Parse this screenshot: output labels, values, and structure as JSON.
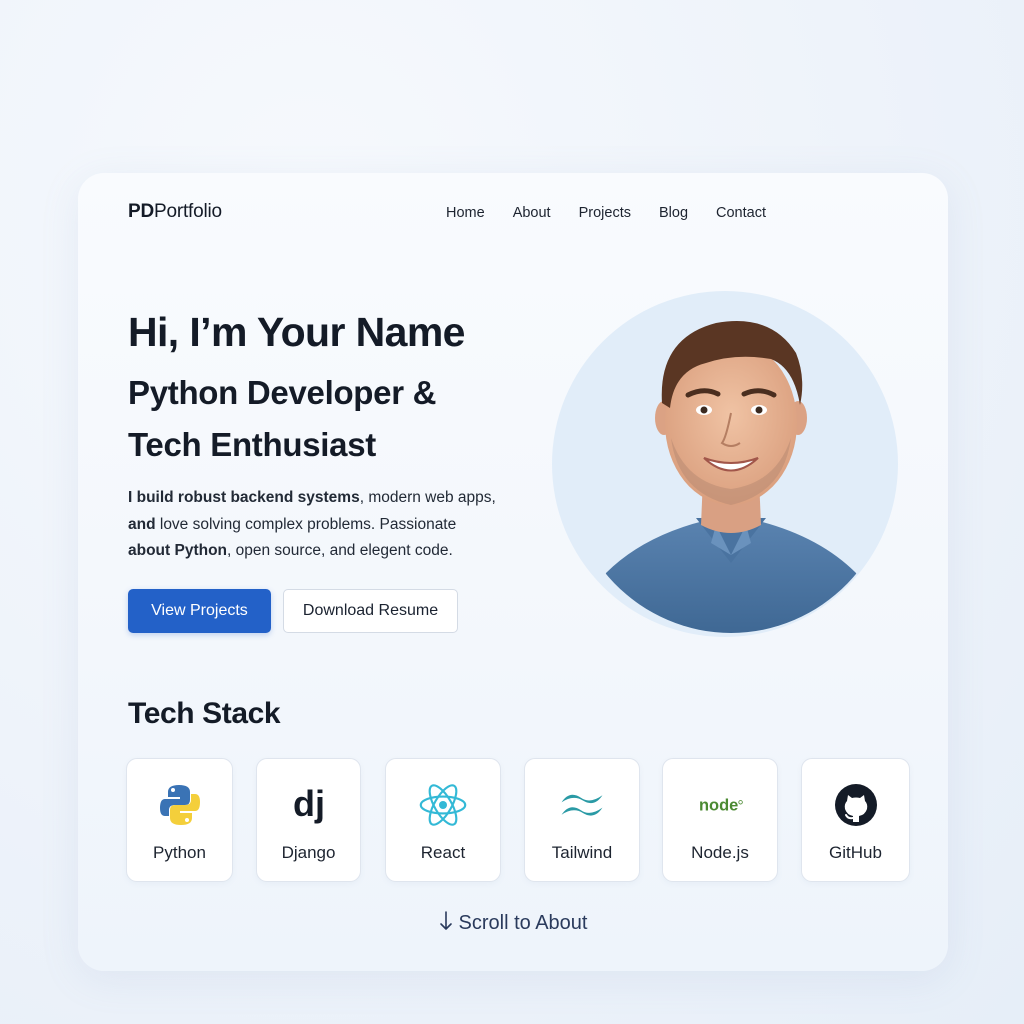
{
  "brand": {
    "bold": "PD",
    "rest": "Portfolio"
  },
  "nav": [
    "Home",
    "About",
    "Projects",
    "Blog",
    "Contact"
  ],
  "hero": {
    "title": "Hi, I’m Your Name",
    "subtitle_line1": "Python Developer &",
    "subtitle_line2": "Tech Enthusiast",
    "desc": {
      "p1_bold": "I build robust backend systems",
      "p1": ", modern web apps,",
      "p2_bold": "and",
      "p2": " love solving complex problems. Passionate",
      "p3_bold": "about Python",
      "p3": ", open source, and elegent code."
    },
    "primary_button": "View Projects",
    "secondary_button": "Download Resume"
  },
  "tech": {
    "title": "Tech Stack",
    "items": [
      {
        "label": "Python",
        "icon": "python-icon"
      },
      {
        "label": "Django",
        "icon": "django-icon"
      },
      {
        "label": "React",
        "icon": "react-icon"
      },
      {
        "label": "Tailwind",
        "icon": "tailwind-icon"
      },
      {
        "label": "Node.js",
        "icon": "nodejs-icon"
      },
      {
        "label": "GitHub",
        "icon": "github-icon"
      }
    ]
  },
  "scroll": {
    "label": "Scroll to About"
  },
  "colors": {
    "accent": "#2361c8",
    "text": "#141b27",
    "python_blue": "#3a73b5",
    "python_yellow": "#f4cf3b",
    "react": "#33b9d6",
    "tailwind": "#2a9aa5",
    "node": "#4b8a32"
  }
}
